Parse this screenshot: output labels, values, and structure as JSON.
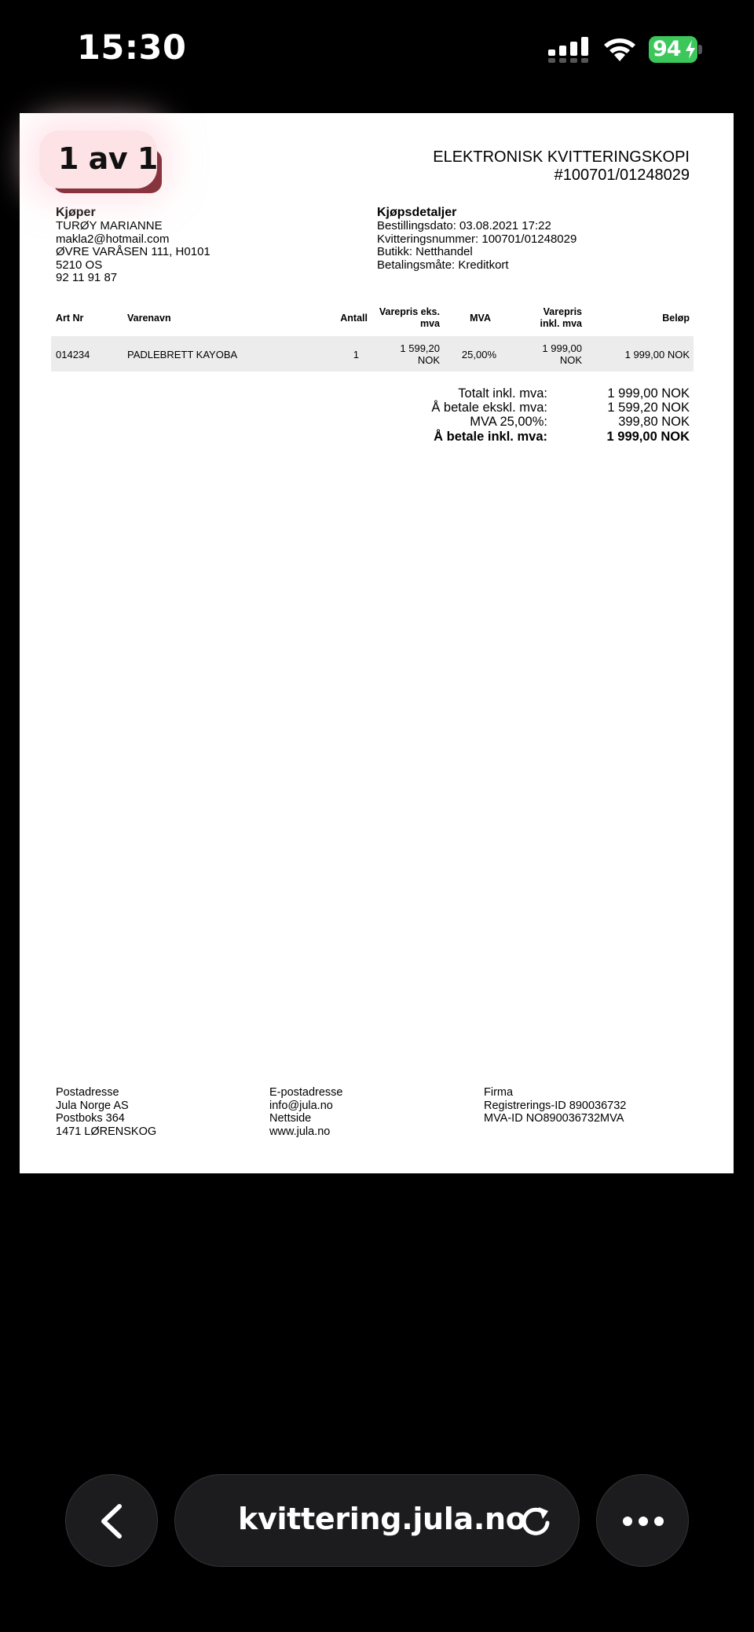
{
  "status_bar": {
    "time": "15:30",
    "battery_percent": "94",
    "icons": [
      "signal-icon",
      "wifi-icon",
      "battery-charging-icon"
    ]
  },
  "viewer": {
    "page_counter": "1 av 1"
  },
  "receipt": {
    "title": "ELEKTRONISK KVITTERINGSKOPI",
    "number": "#100701/01248029",
    "buyer": {
      "heading": "Kjøper",
      "name": "TURØY MARIANNE",
      "email": "makla2@hotmail.com",
      "address": "ØVRE VARÅSEN 111, H0101",
      "postal": "5210 OS",
      "phone": "92 11 91 87"
    },
    "details": {
      "heading": "Kjøpsdetaljer",
      "order_date": "Bestillingsdato: 03.08.2021 17:22",
      "receipt_no": "Kvitteringsnummer: 100701/01248029",
      "store": "Butikk: Netthandel",
      "payment": "Betalingsmåte: Kreditkort"
    },
    "table": {
      "headers": {
        "art_nr": "Art Nr",
        "name": "Varenavn",
        "qty": "Antall",
        "price_ex_1": "Varepris eks.",
        "price_ex_2": "mva",
        "vat": "MVA",
        "price_inc_1": "Varepris",
        "price_inc_2": "inkl. mva",
        "amount": "Beløp"
      },
      "rows": [
        {
          "art_nr": "014234",
          "name": "PADLEBRETT KAYOBA",
          "qty": "1",
          "price_ex_1": "1 599,20",
          "price_ex_2": "NOK",
          "vat": "25,00%",
          "price_inc_1": "1 999,00",
          "price_inc_2": "NOK",
          "amount": "1 999,00 NOK"
        }
      ]
    },
    "totals": [
      {
        "label": "Totalt inkl. mva:",
        "value": "1 999,00 NOK"
      },
      {
        "label": "Å betale ekskl. mva:",
        "value": "1 599,20 NOK"
      },
      {
        "label": "MVA 25,00%:",
        "value": "399,80 NOK"
      },
      {
        "label": "Å betale inkl. mva:",
        "value": "1 999,00 NOK"
      }
    ],
    "footer": {
      "postal": [
        "Postadresse",
        "Jula Norge AS",
        "Postboks 364",
        "1471 LØRENSKOG"
      ],
      "email": [
        "E-postadresse",
        "info@jula.no",
        "Nettside",
        "www.jula.no"
      ],
      "company": [
        "Firma",
        "Registrerings-ID 890036732",
        "MVA-ID NO890036732MVA"
      ]
    }
  },
  "bottom_bar": {
    "url": "kvittering.jula.no",
    "icons": [
      "back-icon",
      "reload-icon",
      "more-icon"
    ]
  }
}
